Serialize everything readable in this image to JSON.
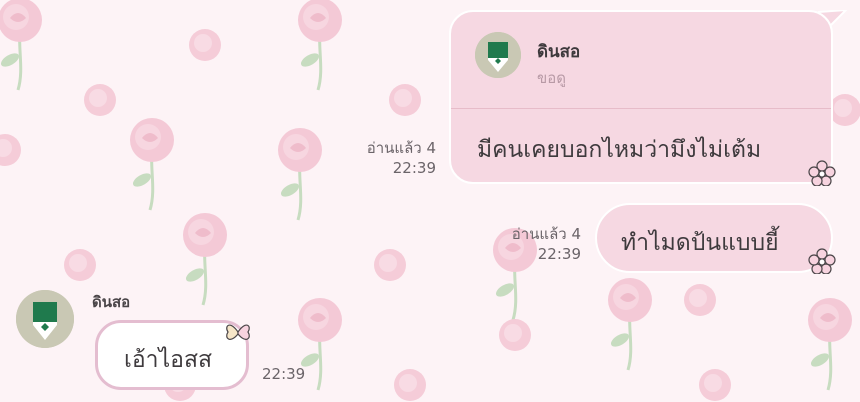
{
  "theme": {
    "background": "#fdf3f6",
    "bubble_out": "#f6d8e2",
    "bubble_in": "#ffffff",
    "bubble_in_border": "#e4bdd0",
    "rose_color": "#f4c9d6",
    "leaf_color": "#c7dcc0",
    "avatar_icon": "pencil-icon"
  },
  "messages": {
    "reply": {
      "quoted_name": "ดินสอ",
      "quoted_text": "ขอดู",
      "text": "มีคนเคยบอกไหมว่ามึงไม่เต้ม",
      "read_status": "อ่านแล้ว 4",
      "time": "22:39"
    },
    "outgoing": {
      "text": "ทำไมดป้นแบบยี้",
      "read_status": "อ่านแล้ว 4",
      "time": "22:39"
    },
    "incoming": {
      "sender": "ดินสอ",
      "text": "เอ้าไอสส",
      "time": "22:39"
    }
  }
}
